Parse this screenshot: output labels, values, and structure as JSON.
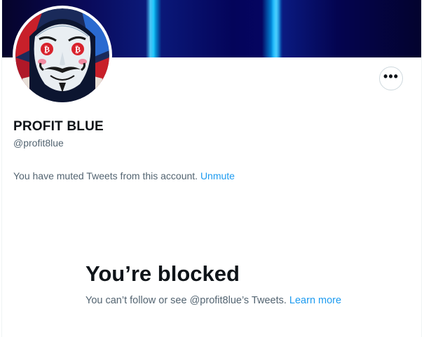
{
  "profile": {
    "name": "PROFIT BLUE",
    "handle": "@profit8lue"
  },
  "muted_notice": {
    "text": "You have muted Tweets from this account. ",
    "unmute_label": "Unmute"
  },
  "blocked": {
    "title": "You’re blocked",
    "text": "You can’t follow or see @profit8lue’s Tweets. ",
    "learn_more": "Learn more"
  },
  "icons": {
    "more": "more-horizontal-icon"
  },
  "colors": {
    "link": "#1d9bf0",
    "secondary_text": "#536471",
    "primary_text": "#0f1419"
  }
}
